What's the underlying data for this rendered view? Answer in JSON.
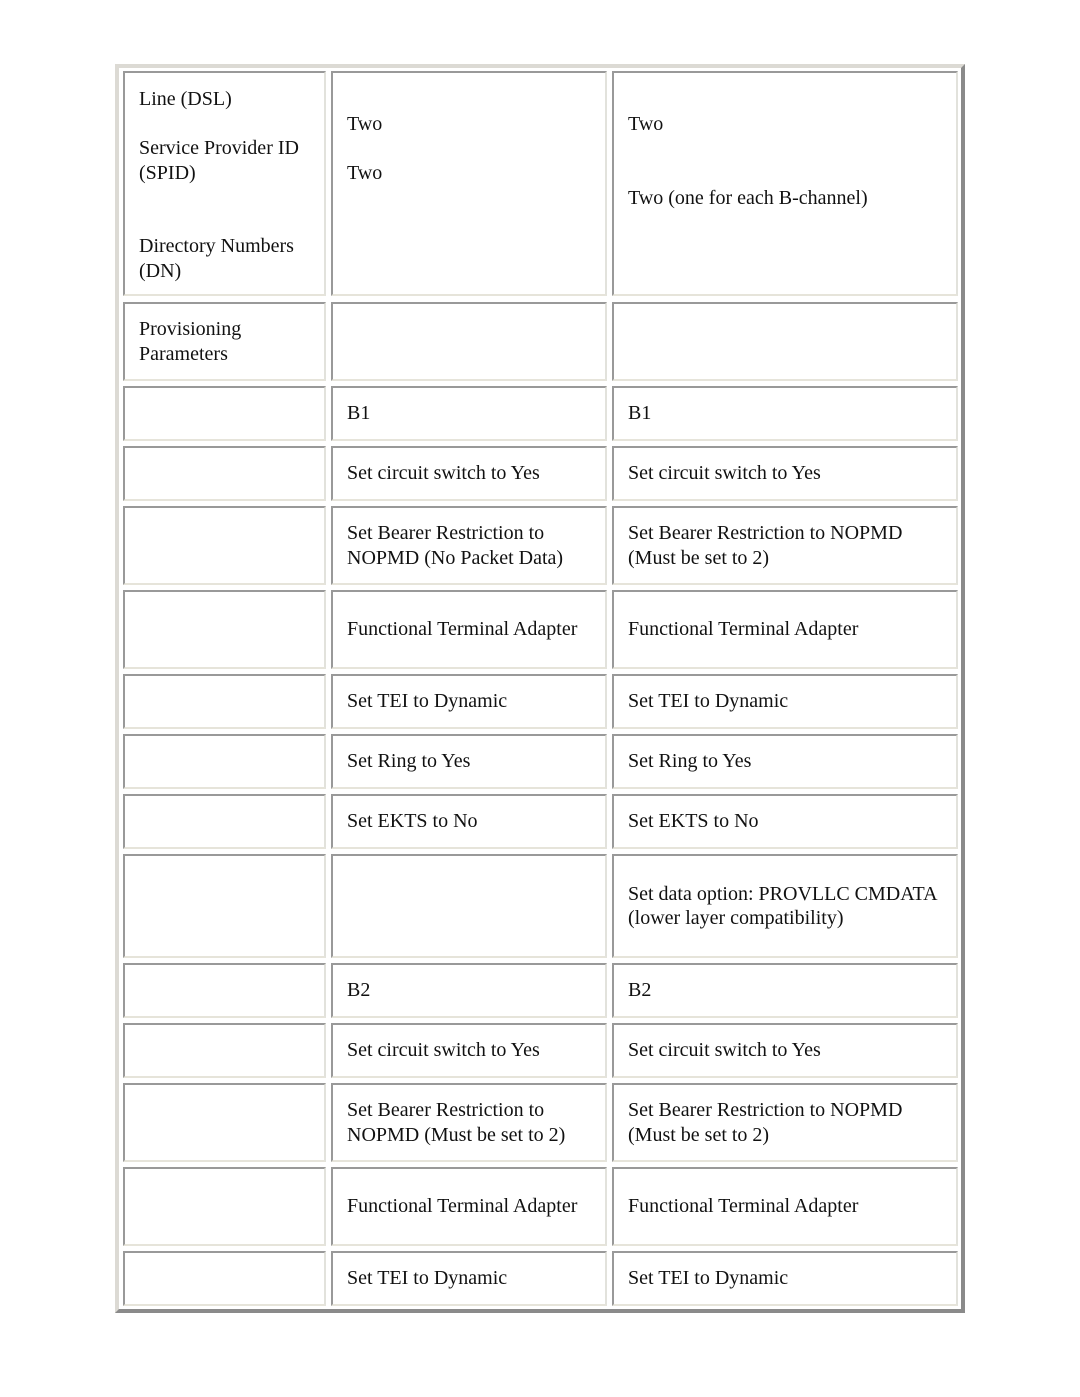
{
  "table": {
    "rows": [
      {
        "col1": {
          "line_label": "Line (DSL)",
          "spid_label": "Service Provider ID (SPID)",
          "dn_label": "Directory Numbers (DN)"
        },
        "col2": {
          "spid_value": "Two",
          "dn_value": "Two"
        },
        "col3": {
          "spid_value": "Two",
          "dn_value": "Two (one for each B-channel)"
        }
      },
      {
        "col1": "Provisioning Parameters",
        "col2": "",
        "col3": ""
      },
      {
        "col1": "",
        "col2": "B1",
        "col3": "B1"
      },
      {
        "col1": "",
        "col2": "Set circuit switch to Yes",
        "col3": "Set circuit switch to Yes"
      },
      {
        "col1": "",
        "col2": "Set Bearer Restriction to NOPMD (No Packet Data)",
        "col3": "Set Bearer Restriction to NOPMD (Must be set to 2)"
      },
      {
        "col1": "",
        "col2": "Functional Terminal Adapter",
        "col3": "Functional Terminal Adapter"
      },
      {
        "col1": "",
        "col2": "Set TEI to Dynamic",
        "col3": "Set TEI to Dynamic"
      },
      {
        "col1": "",
        "col2": "Set Ring to Yes",
        "col3": "Set Ring to Yes"
      },
      {
        "col1": "",
        "col2": "Set EKTS to No",
        "col3": "Set EKTS to No"
      },
      {
        "col1": "",
        "col2": "",
        "col3": "Set data option: PROVLLC CMDATA (lower layer compatibility)"
      },
      {
        "col1": "",
        "col2": "B2",
        "col3": "B2"
      },
      {
        "col1": "",
        "col2": "Set circuit switch to Yes",
        "col3": "Set circuit switch to Yes"
      },
      {
        "col1": "",
        "col2": "Set Bearer Restriction to NOPMD (Must be set to 2)",
        "col3": "Set Bearer Restriction to NOPMD (Must be set to 2)"
      },
      {
        "col1": "",
        "col2": "Functional Terminal Adapter",
        "col3": "Functional Terminal Adapter"
      },
      {
        "col1": "",
        "col2": "Set TEI to Dynamic",
        "col3": "Set TEI to Dynamic"
      }
    ]
  }
}
